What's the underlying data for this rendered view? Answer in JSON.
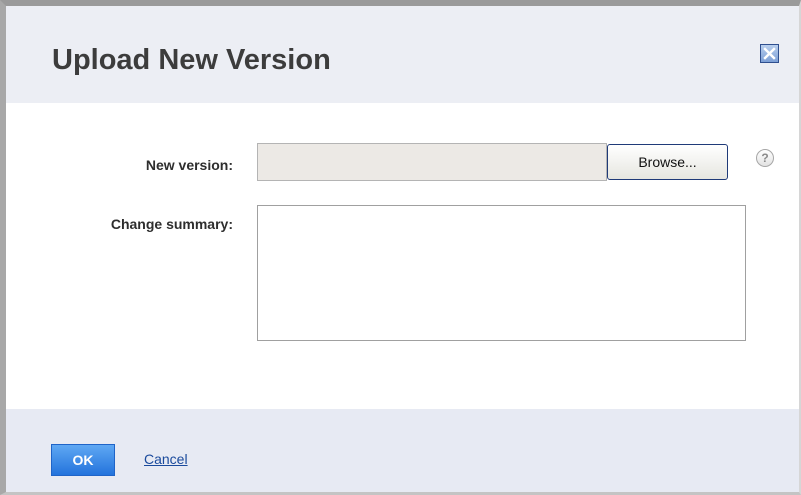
{
  "dialog": {
    "title": "Upload New Version",
    "close_icon": "close-icon"
  },
  "form": {
    "new_version": {
      "label": "New version:",
      "value": "",
      "placeholder": "",
      "browse_label": "Browse...",
      "help_glyph": "?",
      "help_icon": "help-icon"
    },
    "change_summary": {
      "label": "Change summary:",
      "value": ""
    }
  },
  "footer": {
    "ok_label": "OK",
    "cancel_label": "Cancel"
  },
  "colors": {
    "header_bg": "#eceef4",
    "footer_bg": "#e7eaf3",
    "ok_button": "#2373dc",
    "link": "#1a4a9c",
    "close_button": "#7c9fd6"
  }
}
